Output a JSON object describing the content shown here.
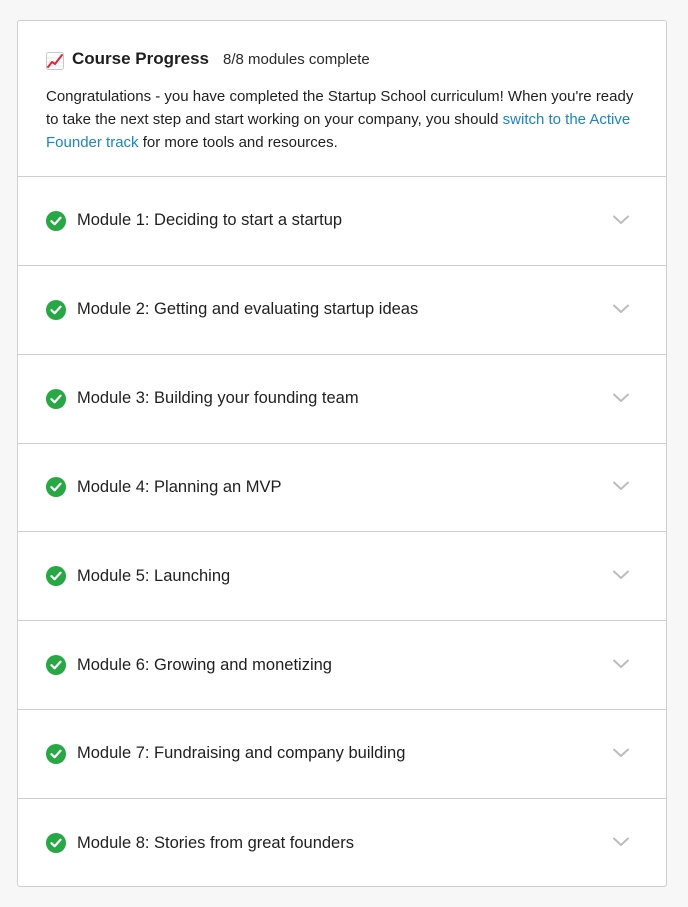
{
  "header": {
    "icon": "chart-increasing-icon",
    "title": "Course Progress",
    "count": "8/8 modules complete",
    "message_before": "Congratulations - you have completed the Startup School curriculum! When you're ready to take the next step and start working on your company, you should ",
    "link_text": "switch to the Active Founder track",
    "message_after": " for more tools and resources."
  },
  "modules": [
    {
      "label": "Module 1: Deciding to start a startup",
      "status": "complete"
    },
    {
      "label": "Module 2: Getting and evaluating startup ideas",
      "status": "complete"
    },
    {
      "label": "Module 3: Building your founding team",
      "status": "complete"
    },
    {
      "label": "Module 4: Planning an MVP",
      "status": "complete"
    },
    {
      "label": "Module 5: Launching",
      "status": "complete"
    },
    {
      "label": "Module 6: Growing and monetizing",
      "status": "complete"
    },
    {
      "label": "Module 7: Fundraising and company building",
      "status": "complete"
    },
    {
      "label": "Module 8: Stories from great founders",
      "status": "complete"
    }
  ],
  "colors": {
    "check": "#28a745",
    "link": "#1a86c5",
    "border": "#cfcfcf",
    "chevron": "#bdbdbd"
  }
}
